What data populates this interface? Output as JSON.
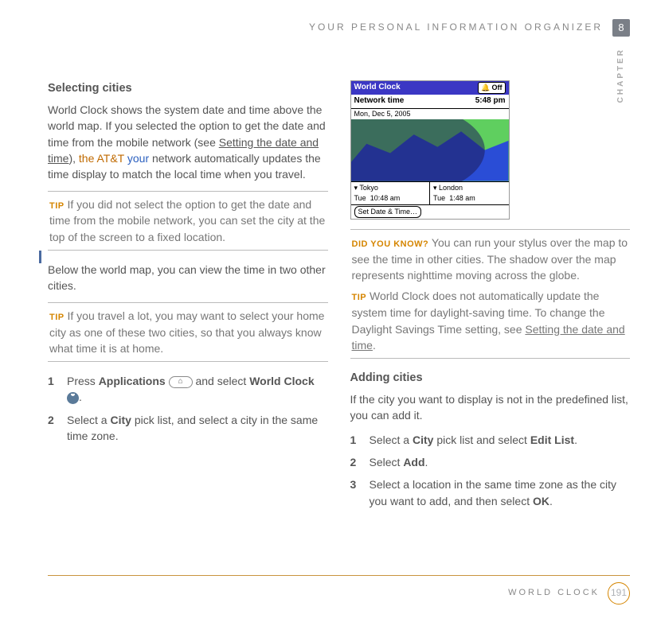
{
  "header": {
    "title": "YOUR PERSONAL INFORMATION ORGANIZER",
    "chapter_num": "8",
    "chapter_label": "CHAPTER"
  },
  "left": {
    "h1": "Selecting cities",
    "p1a": "World Clock shows the system date and time above the world map. If you selected the option to get the date and time from the mobile network (see ",
    "p1link": "Setting the date and time",
    "p1b": "), ",
    "p1brand": "the AT&T ",
    "p1your": "your",
    "p1c": " network automatically updates the time display to match the local time when you travel.",
    "tip1_label": "TIP",
    "tip1": "If you did not select the option to get the date and time from the mobile network, you can set the city at the top of the screen to a fixed location.",
    "p2": "Below the world map, you can view the time in two other cities.",
    "tip2_label": "TIP",
    "tip2": "If you travel a lot, you may want to select your home city as one of these two cities, so that you always know what time it is at home.",
    "steps": [
      {
        "a": "Press ",
        "b": "Applications",
        "c": " and select ",
        "d": "World Clock",
        "e": "."
      },
      {
        "a": "Select a ",
        "b": "City",
        "c": " pick list, and select a city in the same time zone."
      }
    ]
  },
  "right": {
    "screenshot": {
      "title": "World Clock",
      "off": "Off",
      "net": "Network time",
      "date": "Mon, Dec 5, 2005",
      "time": "5:48 pm",
      "city1": "Tokyo",
      "day1": "Tue",
      "t1": "10:48 am",
      "city2": "London",
      "day2": "Tue",
      "t2": "1:48 am",
      "button": "Set Date & Time…"
    },
    "dyk_label": "DID YOU KNOW?",
    "dyk": "You can run your stylus over the map to see the time in other cities. The shadow over the map represents nighttime moving across the globe.",
    "tip3_label": "TIP",
    "tip3a": "World Clock does not automatically update the system time for daylight-saving time. To change the Daylight Savings Time setting, see ",
    "tip3link": "Setting the date and time",
    "tip3b": ".",
    "h2": "Adding cities",
    "p3": "If the city you want to display is not in the predefined list, you can add it.",
    "steps": [
      {
        "a": "Select a ",
        "b": "City",
        "c": " pick list and select ",
        "d": "Edit List",
        "e": "."
      },
      {
        "a": "Select ",
        "b": "Add",
        "c": "."
      },
      {
        "a": "Select a location in the same time zone as the city you want to add, and then select ",
        "b": "OK",
        "c": "."
      }
    ]
  },
  "footer": {
    "title": "WORLD CLOCK",
    "page": "191"
  }
}
